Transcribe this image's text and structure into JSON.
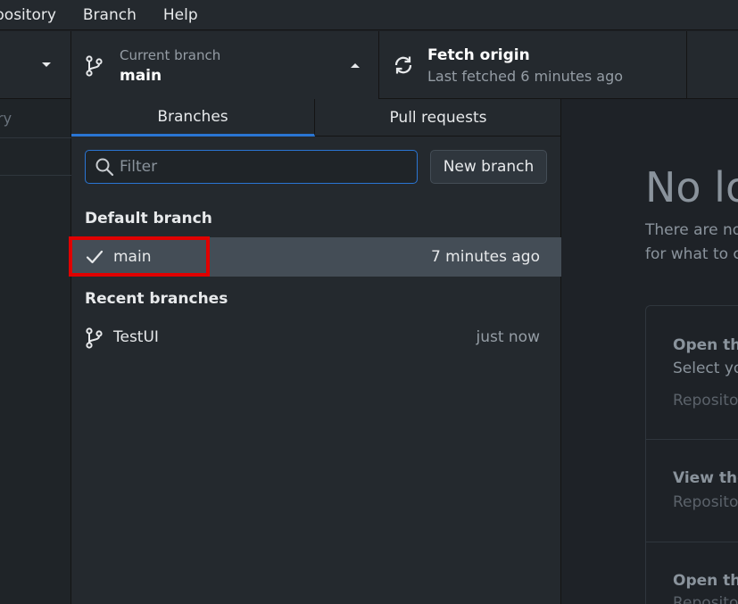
{
  "menubar": {
    "items": [
      "pository",
      "Branch",
      "Help"
    ]
  },
  "toolbar": {
    "branch": {
      "sub_label": "Current branch",
      "name": "main"
    },
    "fetch": {
      "title": "Fetch origin",
      "sub_label": "Last fetched 6 minutes ago"
    }
  },
  "left_pane": {
    "tab_stub": "ry"
  },
  "dropdown": {
    "tabs": {
      "branches": "Branches",
      "pull_requests": "Pull requests"
    },
    "filter": {
      "placeholder": "Filter",
      "value": ""
    },
    "new_branch_label": "New branch",
    "default_section": "Default branch",
    "default_branch": {
      "name": "main",
      "time": "7 minutes ago",
      "selected": true
    },
    "recent_section": "Recent branches",
    "recent_branches": [
      {
        "name": "TestUI",
        "time": "just now"
      }
    ]
  },
  "right_pane": {
    "heading": "No lo",
    "line1": "There are no",
    "line2": "for what to c",
    "cards": [
      {
        "heading": "Open the",
        "text": "Select yo",
        "detail": "Repositor"
      },
      {
        "heading": "View the",
        "detail": "Repositor"
      },
      {
        "heading": "Open the",
        "detail": "Reposito"
      }
    ]
  },
  "colors": {
    "accent": "#2a75d3",
    "selected_row": "#444d56",
    "highlight_annotation": "#e00000",
    "background": "#24292e"
  },
  "icons": {
    "branch": "git-branch-icon",
    "sync": "sync-icon",
    "search": "search-icon",
    "check": "check-icon",
    "caret_down": "caret-down-icon",
    "caret_up": "caret-up-icon"
  }
}
